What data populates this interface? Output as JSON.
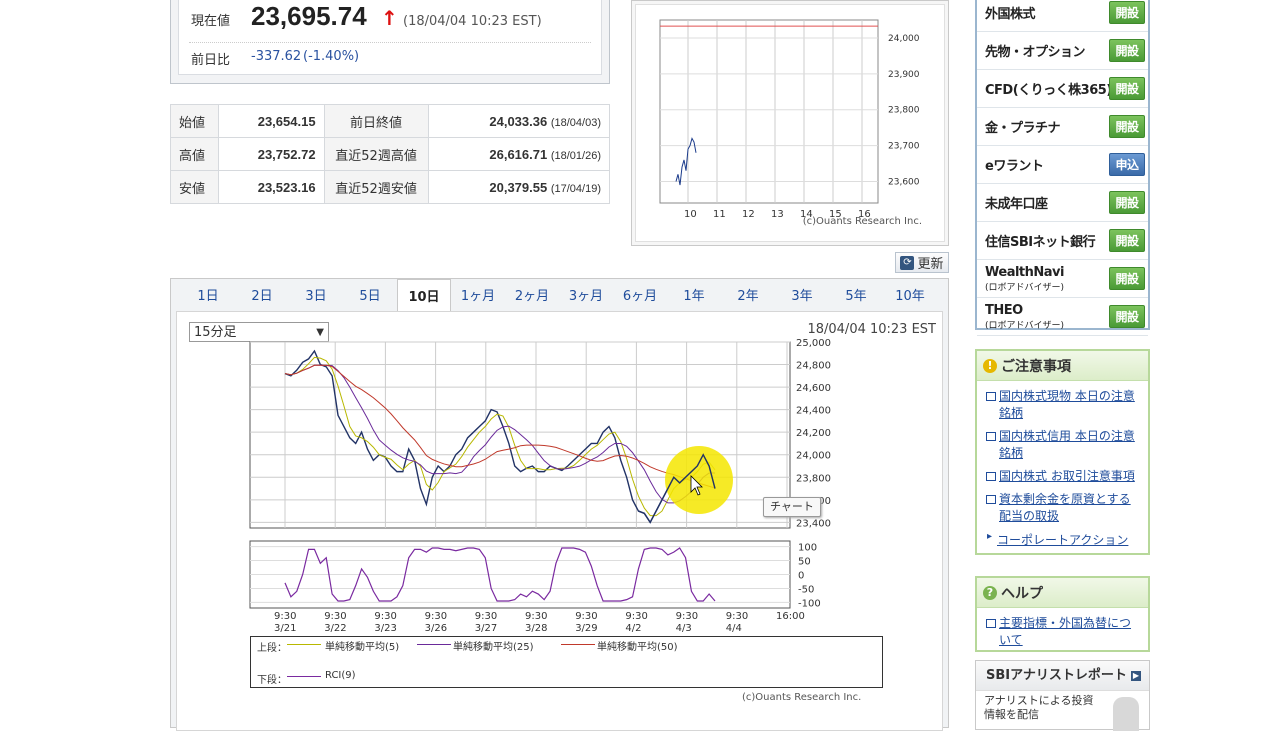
{
  "quote": {
    "current_label": "現在値",
    "current_value": "23,695.74",
    "arrow": "↑",
    "timestamp": "(18/04/04 10:23 EST)",
    "change_label": "前日比",
    "change_value": "-337.62",
    "change_pct": "(-1.40%)"
  },
  "ohlc": {
    "rows": [
      {
        "label": "始値",
        "value": "23,654.15",
        "label2": "前日終値",
        "value2": "24,033.36",
        "date2": "(18/04/03)"
      },
      {
        "label": "高値",
        "value": "23,752.72",
        "label2": "直近52週高値",
        "value2": "26,616.71",
        "date2": "(18/01/26)"
      },
      {
        "label": "安値",
        "value": "23,523.16",
        "label2": "直近52週安値",
        "value2": "20,379.55",
        "date2": "(17/04/19)"
      }
    ]
  },
  "minichart": {
    "y_ticks": [
      "24,000",
      "23,900",
      "23,800",
      "23,700",
      "23,600"
    ],
    "x_ticks": [
      "10",
      "11",
      "12",
      "13",
      "14",
      "15",
      "16"
    ],
    "credit": "(c)Ouants Research Inc."
  },
  "refresh_label": "更新",
  "tabs": [
    "1日",
    "2日",
    "3日",
    "5日",
    "10日",
    "1ヶ月",
    "2ヶ月",
    "3ヶ月",
    "6ヶ月",
    "1年",
    "2年",
    "3年",
    "5年",
    "10年"
  ],
  "active_tab": "10日",
  "interval_select": "15分足",
  "chart_timestamp": "18/04/04 10:23 EST",
  "callout": "チャート",
  "chart_credit": "(c)Ouants Research Inc.",
  "chart_data": {
    "type": "line",
    "main_y_ticks": [
      25000,
      24800,
      24600,
      24400,
      24200,
      24000,
      23800,
      23600,
      23400
    ],
    "main_y_labels": [
      "25,000",
      "24,800",
      "24,600",
      "24,400",
      "24,200",
      "24,000",
      "23,800",
      "23,600",
      "23,400"
    ],
    "ylim": [
      23350,
      25000
    ],
    "rci_y_labels": [
      "100",
      "50",
      "0",
      "-50",
      "-100"
    ],
    "rci_ylim": [
      -120,
      120
    ],
    "x_time_labels": [
      "9:30",
      "9:30",
      "9:30",
      "9:30",
      "9:30",
      "9:30",
      "9:30",
      "9:30",
      "9:30",
      "9:30",
      "16:00"
    ],
    "x_date_labels": [
      "3/21",
      "3/22",
      "3/23",
      "3/26",
      "3/27",
      "3/28",
      "3/29",
      "4/2",
      "4/3",
      "4/4",
      ""
    ],
    "price": [
      24720,
      24700,
      24750,
      24820,
      24850,
      24920,
      24800,
      24780,
      24700,
      24350,
      24250,
      24150,
      24100,
      24200,
      24050,
      23950,
      24000,
      23980,
      23900,
      23850,
      23850,
      24050,
      23950,
      23700,
      23560,
      23800,
      23900,
      23850,
      23900,
      24000,
      24050,
      24150,
      24200,
      24250,
      24300,
      24400,
      24380,
      24250,
      24100,
      23900,
      23850,
      23880,
      23900,
      23850,
      23850,
      23900,
      23880,
      23860,
      23900,
      23950,
      24000,
      24050,
      24100,
      24100,
      24200,
      24250,
      24150,
      23950,
      23800,
      23600,
      23500,
      23480,
      23400,
      23500,
      23600,
      23700,
      23800,
      23750,
      23800,
      23850,
      23900,
      24000,
      23900,
      23700
    ],
    "series": [
      {
        "name": "単純移動平均(5)",
        "color": "#b8b800"
      },
      {
        "name": "単純移動平均(25)",
        "color": "#6a2a9a"
      },
      {
        "name": "単純移動平均(50)",
        "color": "#c0392b"
      },
      {
        "name": "RCI(9)",
        "color": "#7a2aa0"
      }
    ],
    "rci": [
      -30,
      -80,
      -60,
      0,
      90,
      90,
      40,
      60,
      -70,
      -95,
      -95,
      -90,
      -40,
      20,
      -10,
      -60,
      -95,
      -95,
      -95,
      -80,
      -40,
      60,
      90,
      90,
      80,
      95,
      95,
      90,
      90,
      85,
      90,
      95,
      95,
      90,
      60,
      -50,
      -95,
      -95,
      -95,
      -90,
      -70,
      -80,
      -60,
      -70,
      -90,
      -60,
      40,
      95,
      95,
      95,
      90,
      80,
      30,
      -40,
      -95,
      -95,
      -95,
      -95,
      -90,
      -80,
      20,
      90,
      95,
      95,
      90,
      70,
      80,
      95,
      60,
      -60,
      -95,
      -95,
      -70,
      -95
    ],
    "legend_upper_label": "上段：",
    "legend_lower_label": "下段："
  },
  "sidebar": {
    "items": [
      {
        "label": "外国株式",
        "sub": "",
        "button": "開設",
        "blue": false
      },
      {
        "label": "先物・オプション",
        "sub": "",
        "button": "開設",
        "blue": false
      },
      {
        "label": "CFD(くりっく株365)",
        "sub": "",
        "button": "開設",
        "blue": false
      },
      {
        "label": "金・プラチナ",
        "sub": "",
        "button": "開設",
        "blue": false
      },
      {
        "label": "eワラント",
        "sub": "",
        "button": "申込",
        "blue": true
      },
      {
        "label": "未成年口座",
        "sub": "",
        "button": "開設",
        "blue": false
      },
      {
        "label": "住信SBIネット銀行",
        "sub": "",
        "button": "開設",
        "blue": false
      },
      {
        "label": "WealthNavi",
        "sub": "(ロボアドバイザー)",
        "button": "開設",
        "blue": false
      },
      {
        "label": "THEO",
        "sub": "(ロボアドバイザー)",
        "button": "開設",
        "blue": false
      }
    ]
  },
  "notice": {
    "title": "ご注意事項",
    "items": [
      "国内株式現物 本日の注意銘柄",
      "国内株式信用 本日の注意銘柄",
      "国内株式 お取引注意事項",
      "資本剰余金を原資とする配当の取扱"
    ],
    "corp_action": "コーポレートアクション"
  },
  "help": {
    "title": "ヘルプ",
    "items": [
      "主要指標・外国為替について"
    ]
  },
  "sbi_report": {
    "title": "SBIアナリストレポート",
    "text": "アナリストによる投資情報を配信"
  }
}
